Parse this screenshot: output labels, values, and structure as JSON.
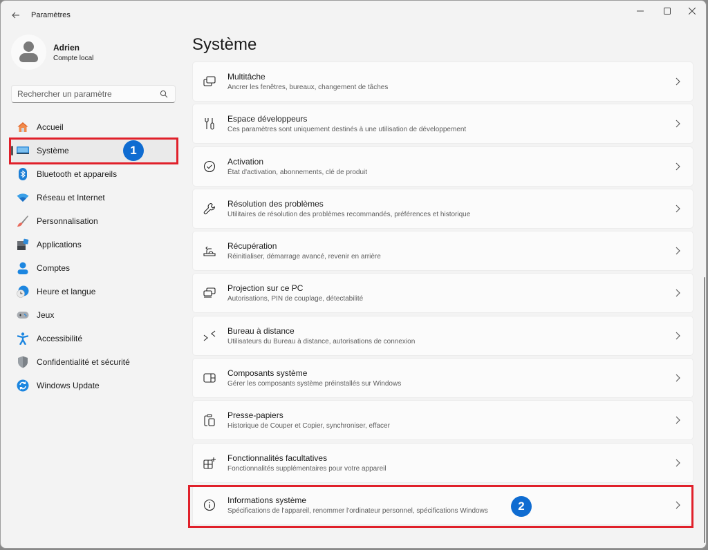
{
  "window": {
    "title": "Paramètres",
    "controls": {
      "minimize": "minimize",
      "maximize": "maximize",
      "close": "close"
    }
  },
  "profile": {
    "name": "Adrien",
    "account_type": "Compte local"
  },
  "search": {
    "placeholder": "Rechercher un paramètre",
    "value": ""
  },
  "sidebar": {
    "items": [
      {
        "label": "Accueil",
        "icon": "home-icon",
        "active": false
      },
      {
        "label": "Système",
        "icon": "system-icon",
        "active": true
      },
      {
        "label": "Bluetooth et appareils",
        "icon": "bluetooth-icon",
        "active": false
      },
      {
        "label": "Réseau et Internet",
        "icon": "wifi-icon",
        "active": false
      },
      {
        "label": "Personnalisation",
        "icon": "brush-icon",
        "active": false
      },
      {
        "label": "Applications",
        "icon": "apps-icon",
        "active": false
      },
      {
        "label": "Comptes",
        "icon": "account-icon",
        "active": false
      },
      {
        "label": "Heure et langue",
        "icon": "clock-globe-icon",
        "active": false
      },
      {
        "label": "Jeux",
        "icon": "gamepad-icon",
        "active": false
      },
      {
        "label": "Accessibilité",
        "icon": "accessibility-icon",
        "active": false
      },
      {
        "label": "Confidentialité et sécurité",
        "icon": "shield-icon",
        "active": false
      },
      {
        "label": "Windows Update",
        "icon": "update-icon",
        "active": false
      }
    ]
  },
  "main": {
    "title": "Système",
    "cards": [
      {
        "title": "Multitâche",
        "subtitle": "Ancrer les fenêtres, bureaux, changement de tâches",
        "icon": "multitask-icon"
      },
      {
        "title": "Espace développeurs",
        "subtitle": "Ces paramètres sont uniquement destinés à une utilisation de développement",
        "icon": "developer-tools-icon"
      },
      {
        "title": "Activation",
        "subtitle": "État d'activation, abonnements, clé de produit",
        "icon": "check-circle-icon"
      },
      {
        "title": "Résolution des problèmes",
        "subtitle": "Utilitaires de résolution des problèmes recommandés, préférences et historique",
        "icon": "wrench-icon"
      },
      {
        "title": "Récupération",
        "subtitle": "Réinitialiser, démarrage avancé, revenir en arrière",
        "icon": "recovery-icon"
      },
      {
        "title": "Projection sur ce PC",
        "subtitle": "Autorisations, PIN de couplage, détectabilité",
        "icon": "projection-icon"
      },
      {
        "title": "Bureau à distance",
        "subtitle": "Utilisateurs du Bureau à distance, autorisations de connexion",
        "icon": "remote-desktop-icon"
      },
      {
        "title": "Composants système",
        "subtitle": "Gérer les composants système préinstallés sur Windows",
        "icon": "components-icon"
      },
      {
        "title": "Presse-papiers",
        "subtitle": "Historique de Couper et Copier, synchroniser, effacer",
        "icon": "clipboard-icon"
      },
      {
        "title": "Fonctionnalités facultatives",
        "subtitle": "Fonctionnalités supplémentaires pour votre appareil",
        "icon": "optional-features-icon"
      },
      {
        "title": "Informations système",
        "subtitle": "Spécifications de l'appareil, renommer l'ordinateur personnel, spécifications Windows",
        "icon": "info-icon"
      }
    ]
  },
  "annotations": {
    "badge1": "1",
    "badge2": "2",
    "highlight_color": "#e0202a",
    "badge_color": "#0f6cd1"
  }
}
